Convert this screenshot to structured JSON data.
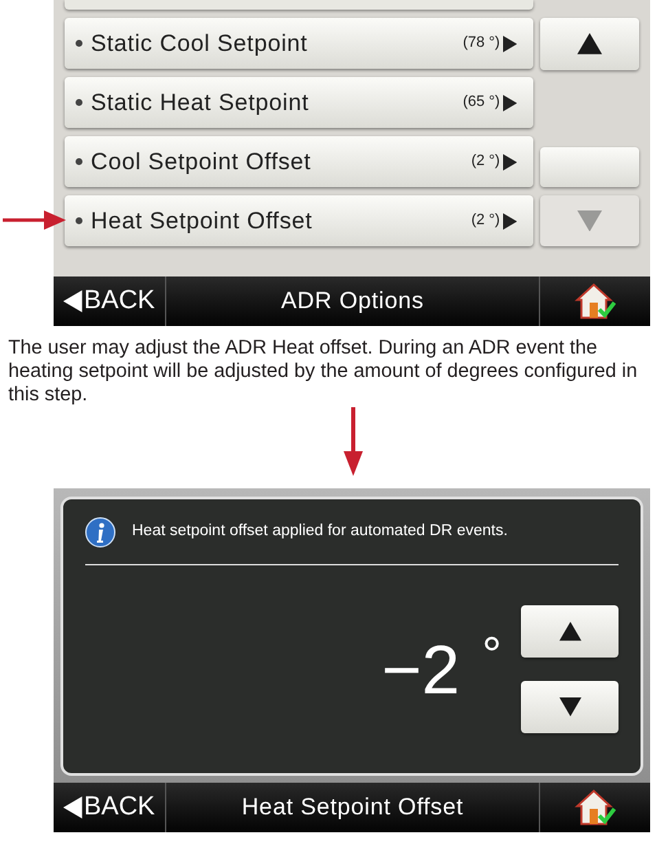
{
  "adr_options_screen": {
    "items": [
      {
        "label": "Static Cool Setpoint",
        "value": "(78 °)",
        "pointed": false
      },
      {
        "label": "Static Heat Setpoint",
        "value": "(65 °)",
        "pointed": false
      },
      {
        "label": "Cool Setpoint Offset",
        "value": "(2 °)",
        "pointed": false
      },
      {
        "label": "Heat Setpoint Offset",
        "value": "(2 °)",
        "pointed": true
      }
    ],
    "scroll_buttons": [
      {
        "kind": "up",
        "disabled": false
      },
      {
        "kind": "blank",
        "disabled": false
      },
      {
        "kind": "down",
        "disabled": true
      }
    ],
    "bottom_bar": {
      "back": "BACK",
      "title": "ADR Options"
    }
  },
  "description": "The user may adjust the ADR Heat offset. During an ADR event the heating setpoint will be adjusted by the amount of degrees configured in this step.",
  "heat_offset_screen": {
    "info": "Heat setpoint offset applied for automated DR events.",
    "value": "−2",
    "unit": "°",
    "buttons": [
      {
        "kind": "up",
        "disabled": false
      },
      {
        "kind": "down",
        "disabled": false
      }
    ],
    "bottom_bar": {
      "back": "BACK",
      "title": "Heat Setpoint Offset"
    }
  }
}
